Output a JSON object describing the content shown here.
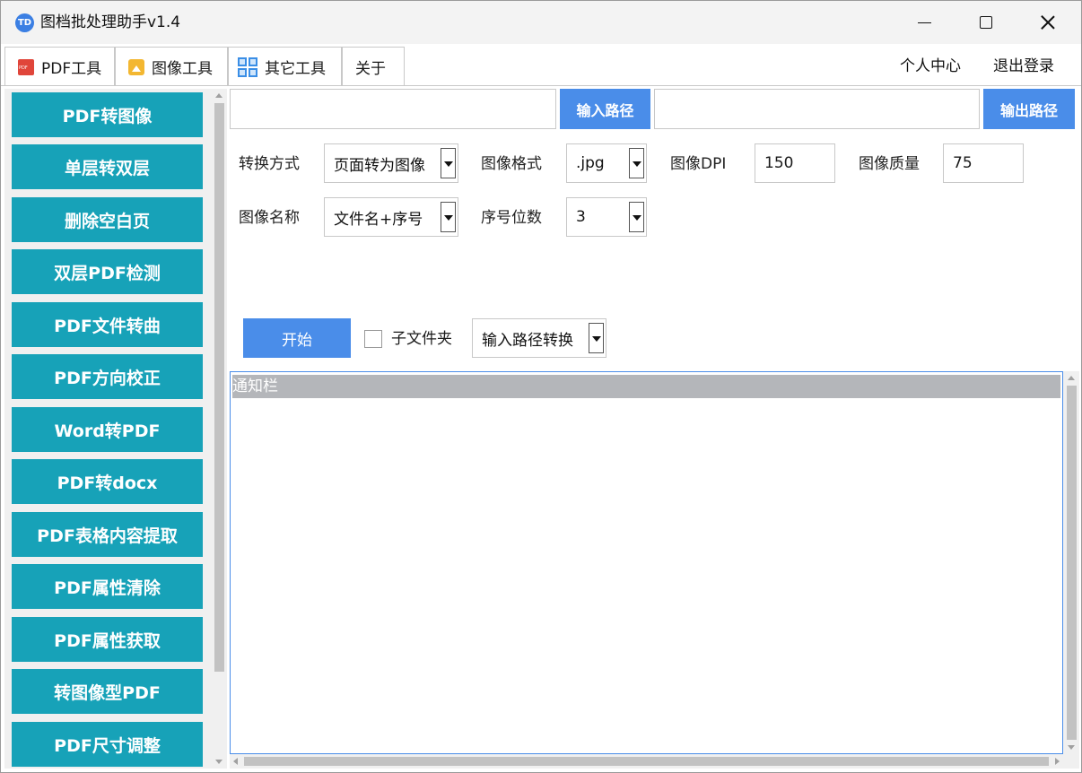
{
  "window": {
    "title": "图档批处理助手v1.4",
    "app_icon": "TD"
  },
  "tabs": [
    {
      "label": "PDF工具",
      "icon": "pdf-icon",
      "active": true
    },
    {
      "label": "图像工具",
      "icon": "image-icon",
      "active": false
    },
    {
      "label": "其它工具",
      "icon": "grid-icon",
      "active": false
    },
    {
      "label": "关于",
      "active": false
    }
  ],
  "top_links": {
    "user_center": "个人中心",
    "logout": "退出登录"
  },
  "sidebar": {
    "items": [
      "PDF转图像",
      "单层转双层",
      "删除空白页",
      "双层PDF检测",
      "PDF文件转曲",
      "PDF方向校正",
      "Word转PDF",
      "PDF转docx",
      "PDF表格内容提取",
      "PDF属性清除",
      "PDF属性获取",
      "转图像型PDF",
      "PDF尺寸调整"
    ]
  },
  "paths": {
    "input_value": "",
    "input_button": "输入路径",
    "output_value": "",
    "output_button": "输出路径"
  },
  "options": {
    "convert_mode_label": "转换方式",
    "convert_mode_value": "页面转为图像",
    "image_format_label": "图像格式",
    "image_format_value": ".jpg",
    "image_dpi_label": "图像DPI",
    "image_dpi_value": "150",
    "image_quality_label": "图像质量",
    "image_quality_value": "75",
    "image_name_label": "图像名称",
    "image_name_value": "文件名+序号",
    "seq_digits_label": "序号位数",
    "seq_digits_value": "3"
  },
  "actions": {
    "start_button": "开始",
    "subfolder_label": "子文件夹",
    "subfolder_checked": false,
    "path_mode_value": "输入路径转换"
  },
  "notice": {
    "header": "通知栏"
  },
  "colors": {
    "sidebar_button": "#17a2b8",
    "primary_button": "#4a8de9"
  }
}
